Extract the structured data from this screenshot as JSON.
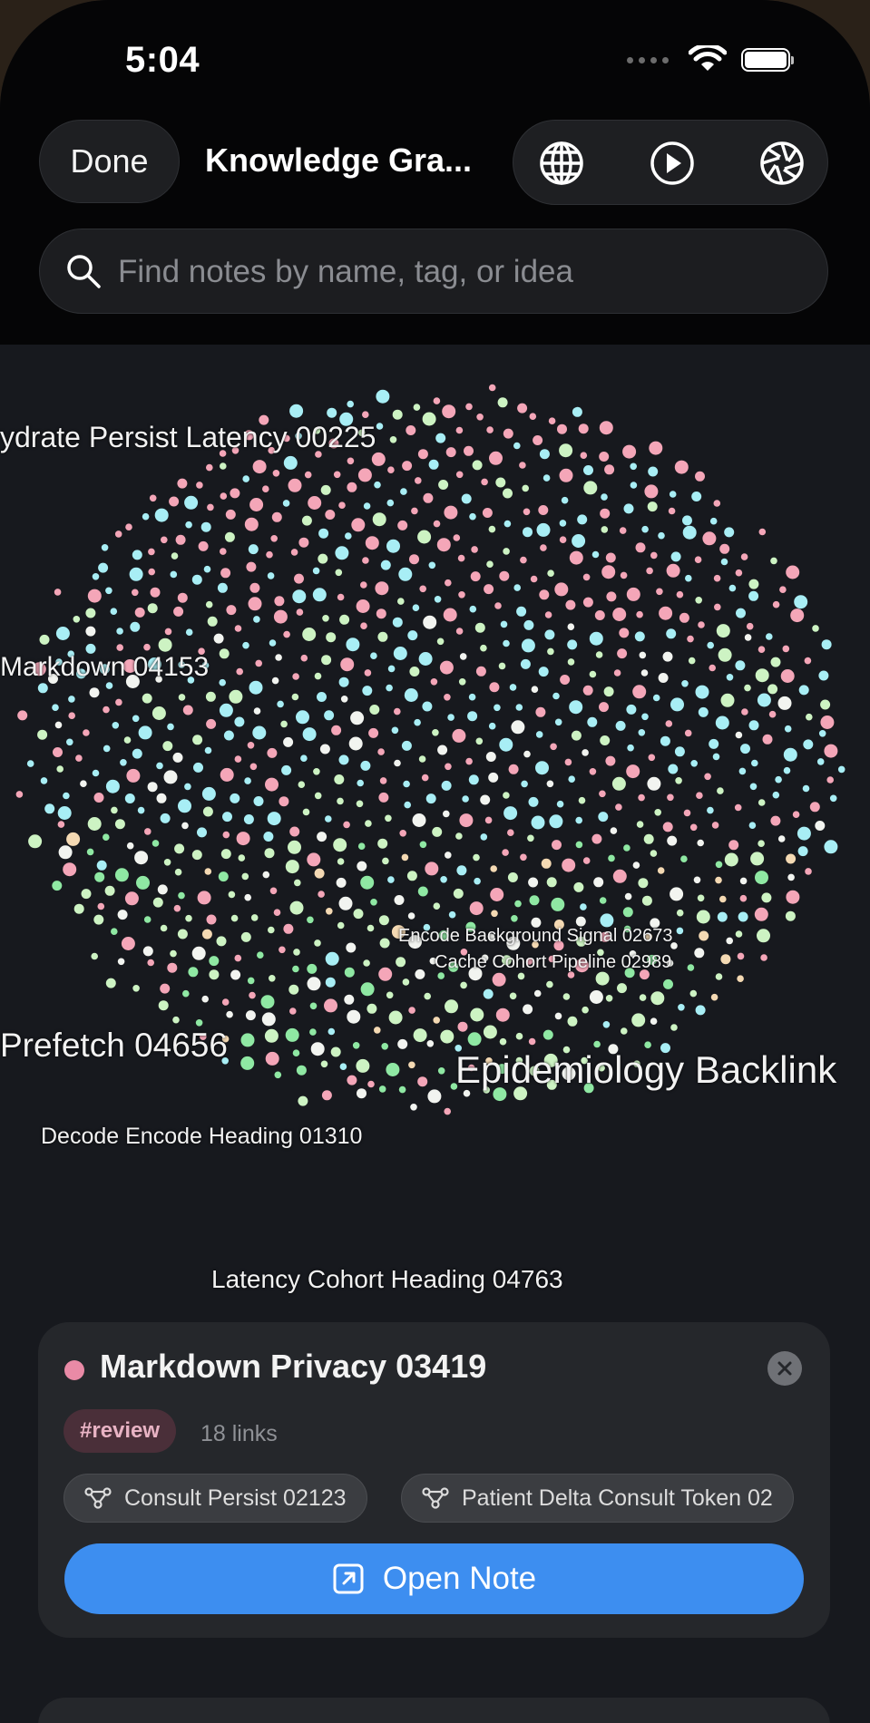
{
  "status_bar": {
    "time": "5:04"
  },
  "header": {
    "done_label": "Done",
    "title": "Knowledge Gra...",
    "tools": [
      "globe-icon",
      "play-icon",
      "aperture-icon"
    ]
  },
  "search": {
    "placeholder": "Find notes by name, tag, or idea",
    "value": ""
  },
  "graph": {
    "node_colors": {
      "pink": "#f4a6b8",
      "cyan": "#a8eef5",
      "lime": "#cdf3c3",
      "green": "#8fe8a3",
      "white": "#f2f4f0",
      "peach": "#f4d9b3"
    },
    "labels": {
      "l1": "ydrate Persist Latency 00225",
      "l2": "Markdown 04153",
      "l3": "Encode Background Signal 02673",
      "l4": "Cache Cohort Pipeline 02989",
      "l5": "Prefetch 04656",
      "l6": "Epidemiology Backlink",
      "l7": "Decode Encode Heading 01310",
      "l8": "Latency Cohort Heading 04763"
    }
  },
  "selected_note": {
    "title": "Markdown Privacy 03419",
    "color": "#e98aa6",
    "tag": "#review",
    "links_count": "18 links",
    "linked_notes": [
      "Consult Persist 02123",
      "Patient Delta Consult Token 02"
    ],
    "open_label": "Open Note"
  }
}
